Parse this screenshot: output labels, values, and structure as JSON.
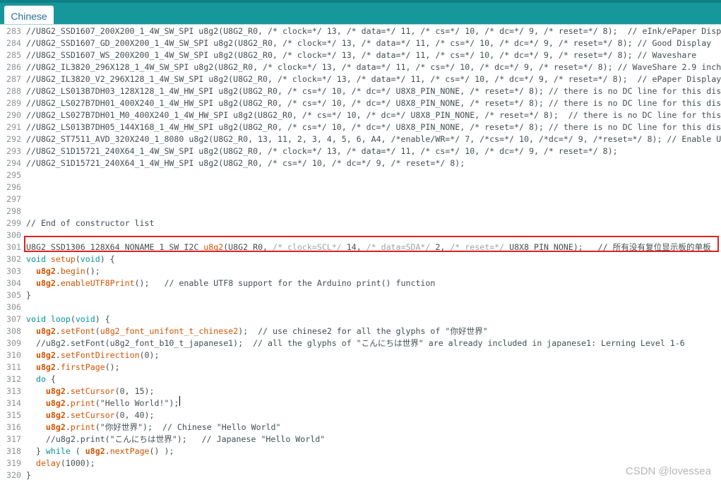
{
  "tab": {
    "label": "Chinese"
  },
  "lines": [
    {
      "n": "283",
      "segs": [
        {
          "t": "//U8G2_SSD1607_200X200_1_4W_SW_SPI u8g2(U8G2_R0, /* clock=*/ 13, /* data=*/ 11, /* cs=*/ 10, /* dc=*/ 9, /* reset=*/ 8);  // eInk/ePaper Displ"
        }
      ]
    },
    {
      "n": "284",
      "segs": [
        {
          "t": "//U8G2_SSD1607_GD_200X200_1_4W_SW_SPI u8g2(U8G2_R0, /* clock=*/ 13, /* data=*/ 11, /* cs=*/ 10, /* dc=*/ 9, /* reset=*/ 8); // Good Display"
        }
      ]
    },
    {
      "n": "285",
      "segs": [
        {
          "t": "//U8G2_SSD1607_WS_200X200_1_4W_SW_SPI u8g2(U8G2_R0, /* clock=*/ 13, /* data=*/ 11, /* cs=*/ 10, /* dc=*/ 9, /* reset=*/ 8); // Waveshare"
        }
      ]
    },
    {
      "n": "286",
      "segs": [
        {
          "t": "//U8G2_IL3820_296X128_1_4W_SW_SPI u8g2(U8G2_R0, /* clock=*/ 13, /* data=*/ 11, /* cs=*/ 10, /* dc=*/ 9, /* reset=*/ 8); // WaveShare 2.9 inch"
        }
      ]
    },
    {
      "n": "287",
      "segs": [
        {
          "t": "//U8G2_IL3820_V2_296X128_1_4W_SW_SPI u8g2(U8G2_R0, /* clock=*/ 13, /* data=*/ 11, /* cs=*/ 10, /* dc=*/ 9, /* reset=*/ 8);  // ePaper Display"
        }
      ]
    },
    {
      "n": "288",
      "segs": [
        {
          "t": "//U8G2_LS013B7DH03_128X128_1_4W_HW_SPI u8g2(U8G2_R0, /* cs=*/ 10, /* dc=*/ U8X8_PIN_NONE, /* reset=*/ 8); // there is no DC line for this dis"
        }
      ]
    },
    {
      "n": "289",
      "segs": [
        {
          "t": "//U8G2_LS027B7DH01_400X240_1_4W_HW_SPI u8g2(U8G2_R0, /* cs=*/ 10, /* dc=*/ U8X8_PIN_NONE, /* reset=*/ 8); // there is no DC line for this dis"
        }
      ]
    },
    {
      "n": "290",
      "segs": [
        {
          "t": "//U8G2_LS027B7DH01_M0_400X240_1_4W_HW_SPI u8g2(U8G2_R0, /* cs=*/ 10, /* dc=*/ U8X8_PIN_NONE, /* reset=*/ 8);  // there is no DC line for this"
        }
      ]
    },
    {
      "n": "291",
      "segs": [
        {
          "t": "//U8G2_LS013B7DH05_144X168_1_4W_HW_SPI u8g2(U8G2_R0, /* cs=*/ 10, /* dc=*/ U8X8_PIN_NONE, /* reset=*/ 8); // there is no DC line for this dis"
        }
      ]
    },
    {
      "n": "292",
      "segs": [
        {
          "t": "//U8G2_ST7511_AVD_320X240_1_8080 u8g2(U8G2_R0, 13, 11, 2, 3, 4, 5, 6, A4, /*enable/WR=*/ 7, /*cs=*/ 10, /*dc=*/ 9, /*reset=*/ 8); // Enable U"
        }
      ]
    },
    {
      "n": "293",
      "segs": [
        {
          "t": "//U8G2_S1D15721_240X64_1_4W_SW_SPI u8g2(U8G2_R0, /* clock=*/ 13, /* data=*/ 11, /* cs=*/ 10, /* dc=*/ 9, /* reset=*/ 8);"
        }
      ]
    },
    {
      "n": "294",
      "segs": [
        {
          "t": "//U8G2_S1D15721_240X64_1_4W_HW_SPI u8g2(U8G2_R0, /* cs=*/ 10, /* dc=*/ 9, /* reset=*/ 8);"
        }
      ]
    },
    {
      "n": "295",
      "segs": []
    },
    {
      "n": "296",
      "segs": []
    },
    {
      "n": "297",
      "segs": []
    },
    {
      "n": "298",
      "segs": []
    },
    {
      "n": "299",
      "segs": [
        {
          "t": "// End of constructor list"
        }
      ]
    },
    {
      "n": "300",
      "segs": []
    },
    {
      "n": "301",
      "segs": [
        {
          "t": "U8G2_SSD1306_128X64_NONAME_1_SW_I2C "
        },
        {
          "t": "u8g2",
          "c": "t-fn"
        },
        {
          "t": "(U8G2_R0, "
        },
        {
          "t": "/* clock=SCL*/",
          "c": "t-comment"
        },
        {
          "t": " 14, "
        },
        {
          "t": "/* data=SDA*/",
          "c": "t-comment"
        },
        {
          "t": " 2, "
        },
        {
          "t": "/* reset=*/",
          "c": "t-comment"
        },
        {
          "t": " U8X8_PIN_NONE);   // 所有没有复位显示板的单板"
        }
      ]
    },
    {
      "n": "302",
      "segs": [
        {
          "t": "void",
          "c": "t-kw"
        },
        {
          "t": " "
        },
        {
          "t": "setup",
          "c": "t-fn"
        },
        {
          "t": "("
        },
        {
          "t": "void",
          "c": "t-kw"
        },
        {
          "t": ") {"
        }
      ]
    },
    {
      "n": "303",
      "segs": [
        {
          "t": "  "
        },
        {
          "t": "u8g2",
          "c": "t-obj"
        },
        {
          "t": "."
        },
        {
          "t": "begin",
          "c": "t-fn"
        },
        {
          "t": "();"
        }
      ]
    },
    {
      "n": "304",
      "segs": [
        {
          "t": "  "
        },
        {
          "t": "u8g2",
          "c": "t-obj"
        },
        {
          "t": "."
        },
        {
          "t": "enableUTF8Print",
          "c": "t-fn"
        },
        {
          "t": "();   // enable UTF8 support for the Arduino print() function"
        }
      ]
    },
    {
      "n": "305",
      "segs": [
        {
          "t": "}"
        }
      ]
    },
    {
      "n": "306",
      "segs": []
    },
    {
      "n": "307",
      "segs": [
        {
          "t": "void",
          "c": "t-kw"
        },
        {
          "t": " "
        },
        {
          "t": "loop",
          "c": "t-kw"
        },
        {
          "t": "("
        },
        {
          "t": "void",
          "c": "t-kw"
        },
        {
          "t": ") {"
        }
      ]
    },
    {
      "n": "308",
      "segs": [
        {
          "t": "  "
        },
        {
          "t": "u8g2",
          "c": "t-obj"
        },
        {
          "t": "."
        },
        {
          "t": "setFont",
          "c": "t-fn"
        },
        {
          "t": "("
        },
        {
          "t": "u8g2_font_unifont_t_chinese2",
          "c": "t-fn"
        },
        {
          "t": ");  // use chinese2 for all the glyphs of \"你好世界\""
        }
      ]
    },
    {
      "n": "309",
      "segs": [
        {
          "t": "  //u8g2.setFont(u8g2_font_b10_t_japanese1);  // all the glyphs of \"こんにちは世界\" are already included in japanese1: Lerning Level 1-6"
        }
      ]
    },
    {
      "n": "310",
      "segs": [
        {
          "t": "  "
        },
        {
          "t": "u8g2",
          "c": "t-obj"
        },
        {
          "t": "."
        },
        {
          "t": "setFontDirection",
          "c": "t-fn"
        },
        {
          "t": "(0);"
        }
      ]
    },
    {
      "n": "311",
      "segs": [
        {
          "t": "  "
        },
        {
          "t": "u8g2",
          "c": "t-obj"
        },
        {
          "t": "."
        },
        {
          "t": "firstPage",
          "c": "t-fn"
        },
        {
          "t": "();"
        }
      ]
    },
    {
      "n": "312",
      "segs": [
        {
          "t": "  "
        },
        {
          "t": "do",
          "c": "t-kw"
        },
        {
          "t": " {"
        }
      ]
    },
    {
      "n": "313",
      "segs": [
        {
          "t": "    "
        },
        {
          "t": "u8g2",
          "c": "t-obj"
        },
        {
          "t": "."
        },
        {
          "t": "setCursor",
          "c": "t-fn"
        },
        {
          "t": "(0, 15);"
        }
      ]
    },
    {
      "n": "314",
      "segs": [
        {
          "t": "    "
        },
        {
          "t": "u8g2",
          "c": "t-obj"
        },
        {
          "t": "."
        },
        {
          "t": "print",
          "c": "t-fn"
        },
        {
          "t": "(\"Hello World!\");"
        }
      ]
    },
    {
      "n": "315",
      "segs": [
        {
          "t": "    "
        },
        {
          "t": "u8g2",
          "c": "t-obj"
        },
        {
          "t": "."
        },
        {
          "t": "setCursor",
          "c": "t-fn"
        },
        {
          "t": "(0, 40);"
        }
      ]
    },
    {
      "n": "316",
      "segs": [
        {
          "t": "    "
        },
        {
          "t": "u8g2",
          "c": "t-obj"
        },
        {
          "t": "."
        },
        {
          "t": "print",
          "c": "t-fn"
        },
        {
          "t": "(\"你好世界\");  // Chinese \"Hello World\""
        }
      ]
    },
    {
      "n": "317",
      "segs": [
        {
          "t": "    //u8g2.print(\"こんにちは世界\");   // Japanese \"Hello World\""
        }
      ]
    },
    {
      "n": "318",
      "segs": [
        {
          "t": "  } "
        },
        {
          "t": "while",
          "c": "t-kw"
        },
        {
          "t": " ( "
        },
        {
          "t": "u8g2",
          "c": "t-obj"
        },
        {
          "t": "."
        },
        {
          "t": "nextPage",
          "c": "t-fn"
        },
        {
          "t": "() );"
        }
      ]
    },
    {
      "n": "319",
      "segs": [
        {
          "t": "  "
        },
        {
          "t": "delay",
          "c": "t-fn"
        },
        {
          "t": "(1000);"
        }
      ]
    },
    {
      "n": "320",
      "segs": [
        {
          "t": "}"
        }
      ]
    }
  ],
  "watermark": "CSDN @lovessea",
  "colors": {
    "topbar": "#16979b",
    "highlight": "#e02020",
    "keyword": "#00979c",
    "function": "#d35400",
    "comment": "#95a5a6"
  }
}
